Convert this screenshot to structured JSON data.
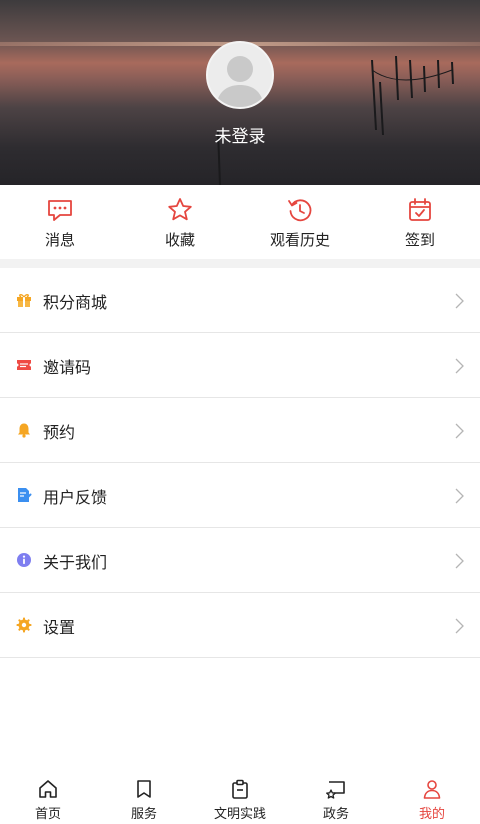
{
  "header": {
    "login_status": "未登录"
  },
  "quick_actions": [
    {
      "label": "消息",
      "icon": "message-icon"
    },
    {
      "label": "收藏",
      "icon": "star-icon"
    },
    {
      "label": "观看历史",
      "icon": "history-icon"
    },
    {
      "label": "签到",
      "icon": "calendar-check-icon"
    }
  ],
  "menu": [
    {
      "label": "积分商城",
      "icon": "gift-icon",
      "color": "#f5a623"
    },
    {
      "label": "邀请码",
      "icon": "ticket-icon",
      "color": "#ef4a43"
    },
    {
      "label": "预约",
      "icon": "bell-icon",
      "color": "#f5a623"
    },
    {
      "label": "用户反馈",
      "icon": "feedback-icon",
      "color": "#3b8ff0"
    },
    {
      "label": "关于我们",
      "icon": "info-icon",
      "color": "#7e7ef0"
    },
    {
      "label": "设置",
      "icon": "gear-icon",
      "color": "#f5a623"
    }
  ],
  "tabbar": [
    {
      "label": "首页",
      "icon": "home-icon"
    },
    {
      "label": "服务",
      "icon": "bookmark-icon"
    },
    {
      "label": "文明实践",
      "icon": "clipboard-icon"
    },
    {
      "label": "政务",
      "icon": "government-icon"
    },
    {
      "label": "我的",
      "icon": "person-icon",
      "active": true
    }
  ],
  "colors": {
    "accent": "#e5463f",
    "text": "#222222",
    "divider": "#e6e6e6"
  }
}
